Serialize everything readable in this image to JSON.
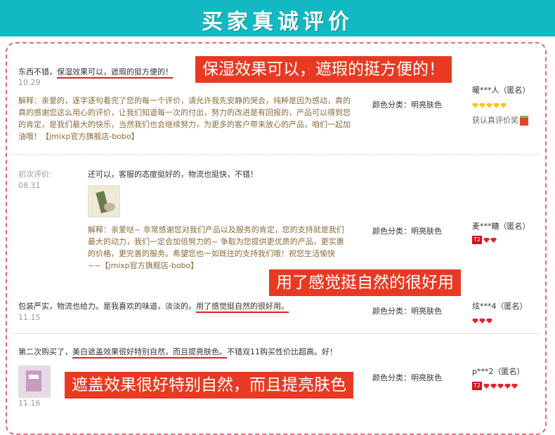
{
  "header": {
    "title": "买家真诚评价"
  },
  "reviews": [
    {
      "text_prefix": "东西不错，",
      "text_highlight": "保湿效果可以，遮瑕的挺方便的！",
      "date": "10.29",
      "reply": "解释：亲爱的，逐字逐句看完了您的每一个评价，请允许我先安静的哭会，纯粹是因为感动，真的真的感谢您这么用心的评价，让我们知道每一次的付出，努力的改进是有回报的，产品可以得到您的肯定，是我们最大的快乐，当然我们也会继续努力，为更多的客户带来放心的产品，咱们一起加油哦！【jmixp官方旗舰店-bobo】",
      "category": "颜色分类：明亮肤色",
      "user": "暖***人（匿名）",
      "award": "获认真评价奖",
      "callout": "保湿效果可以，遮瑕的挺方便的！"
    },
    {
      "initial_label": "初次评价:",
      "date": "08.31",
      "text": "还可以，客服的态度挺好的，物流也挺快，不错！",
      "reply": "解释：亲爱哒~ 非常感谢您对我们产品以及服务的肯定，您的支持就是我们最大的动力，我们一定会加倍努力的~ 争取为您提供更优质的产品，更实惠的价格，更完善的服务。希望您也一如既往的支持我们哦！祝您生活愉快~~【jmixp官方旗舰店-bobo】",
      "category": "颜色分类：明亮肤色",
      "user": "麦***糖（匿名）",
      "badge": "T2"
    },
    {
      "text_prefix": "包装严实，物流也给力。是我喜欢的味道，淡淡的。",
      "text_highlight": "用了感觉挺自然的很好用。",
      "date": "11.15",
      "category": "颜色分类：明亮肤色",
      "user": "炫***4（匿名）",
      "callout": "用了感觉挺自然的很好用"
    },
    {
      "text_prefix": "第二次购买了，",
      "text_highlight": "美白遮盖效果很好特别自然，而且提亮肤色。",
      "text_suffix": "不错双11购买性价比超高。好！",
      "date": "11.16",
      "category": "颜色分类：明亮肤色",
      "user": "p***2（匿名）",
      "badge": "T2",
      "callout": "遮盖效果很好特别自然，而且提亮肤色"
    }
  ]
}
